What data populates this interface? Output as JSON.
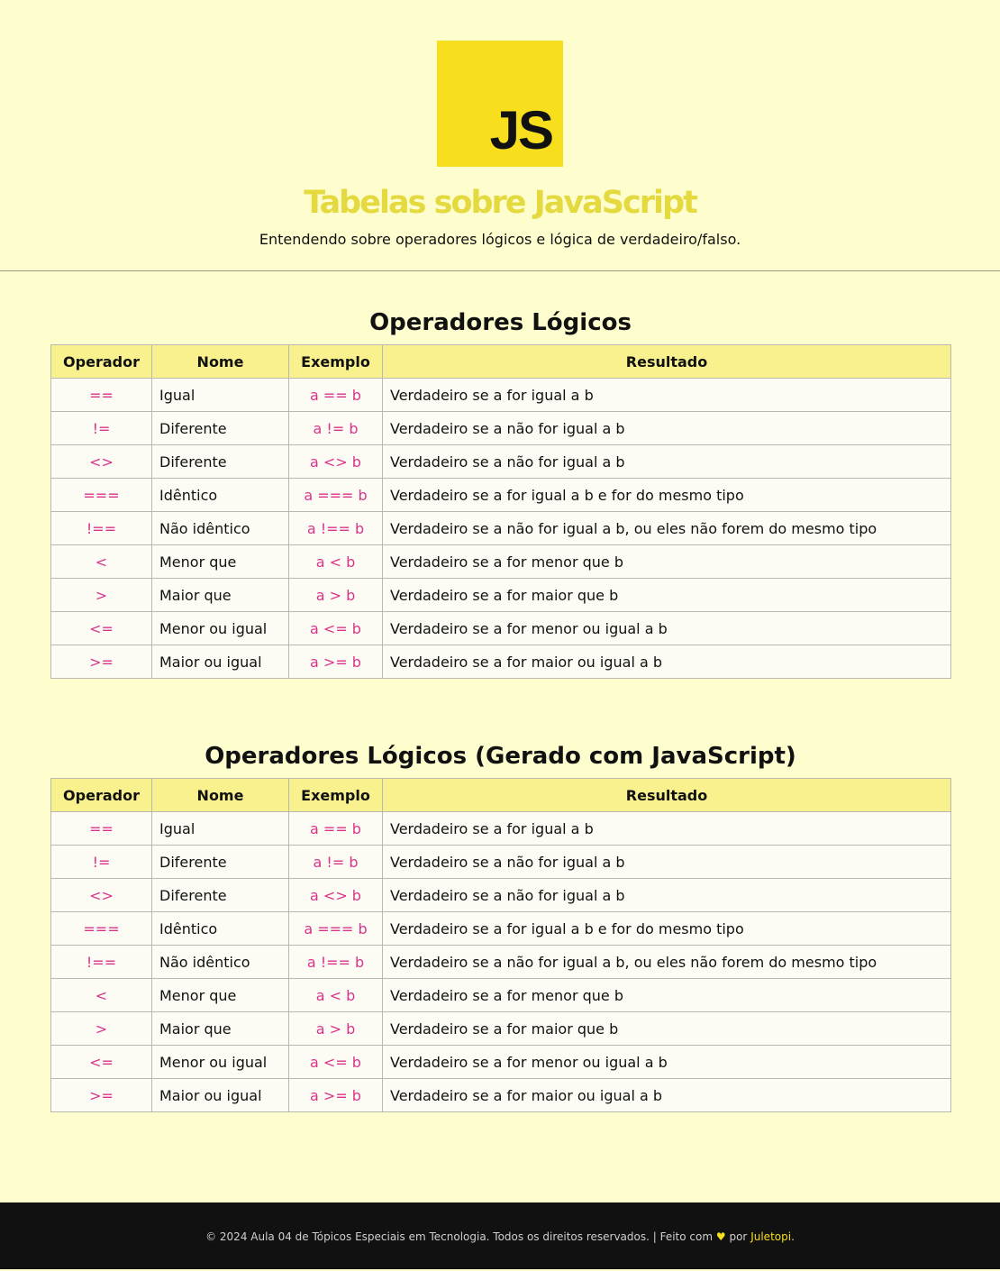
{
  "header": {
    "logo_text": "JS",
    "title": "Tabelas sobre JavaScript",
    "subtitle": "Entendendo sobre operadores lógicos e lógica de verdadeiro/falso."
  },
  "columns": [
    "Operador",
    "Nome",
    "Exemplo",
    "Resultado"
  ],
  "sections": [
    {
      "title": "Operadores Lógicos"
    },
    {
      "title": "Operadores Lógicos (Gerado com JavaScript)"
    }
  ],
  "rows": [
    {
      "op": "==",
      "name": "Igual",
      "ex": "a == b",
      "res": "Verdadeiro se a for igual a b"
    },
    {
      "op": "!=",
      "name": "Diferente",
      "ex": "a != b",
      "res": "Verdadeiro se a não for igual a b"
    },
    {
      "op": "<>",
      "name": "Diferente",
      "ex": "a <> b",
      "res": "Verdadeiro se a não for igual a b"
    },
    {
      "op": "===",
      "name": "Idêntico",
      "ex": "a === b",
      "res": "Verdadeiro se a for igual a b e for do mesmo tipo"
    },
    {
      "op": "!==",
      "name": "Não idêntico",
      "ex": "a !== b",
      "res": "Verdadeiro se a não for igual a b, ou eles não forem do mesmo tipo"
    },
    {
      "op": "<",
      "name": "Menor que",
      "ex": "a < b",
      "res": "Verdadeiro se a for menor que b"
    },
    {
      "op": ">",
      "name": "Maior que",
      "ex": "a > b",
      "res": "Verdadeiro se a for maior que b"
    },
    {
      "op": "<=",
      "name": "Menor ou igual",
      "ex": "a <= b",
      "res": "Verdadeiro se a for menor ou igual a b"
    },
    {
      "op": ">=",
      "name": "Maior ou igual",
      "ex": "a >= b",
      "res": "Verdadeiro se a for maior ou igual a b"
    }
  ],
  "footer": {
    "text": "© 2024 Aula 04 de Tópicos Especiais em Tecnologia. Todos os direitos reservados. | Feito com",
    "heart_icon": "heart-icon",
    "by": "por",
    "author": "Juletopi",
    "end": "."
  },
  "colors": {
    "background": "#fefdce",
    "accent": "#f7df1e",
    "title": "#e4da3f",
    "header_cell": "#f8f18e",
    "operator_text": "#d9348c",
    "footer_bg": "#111111"
  }
}
